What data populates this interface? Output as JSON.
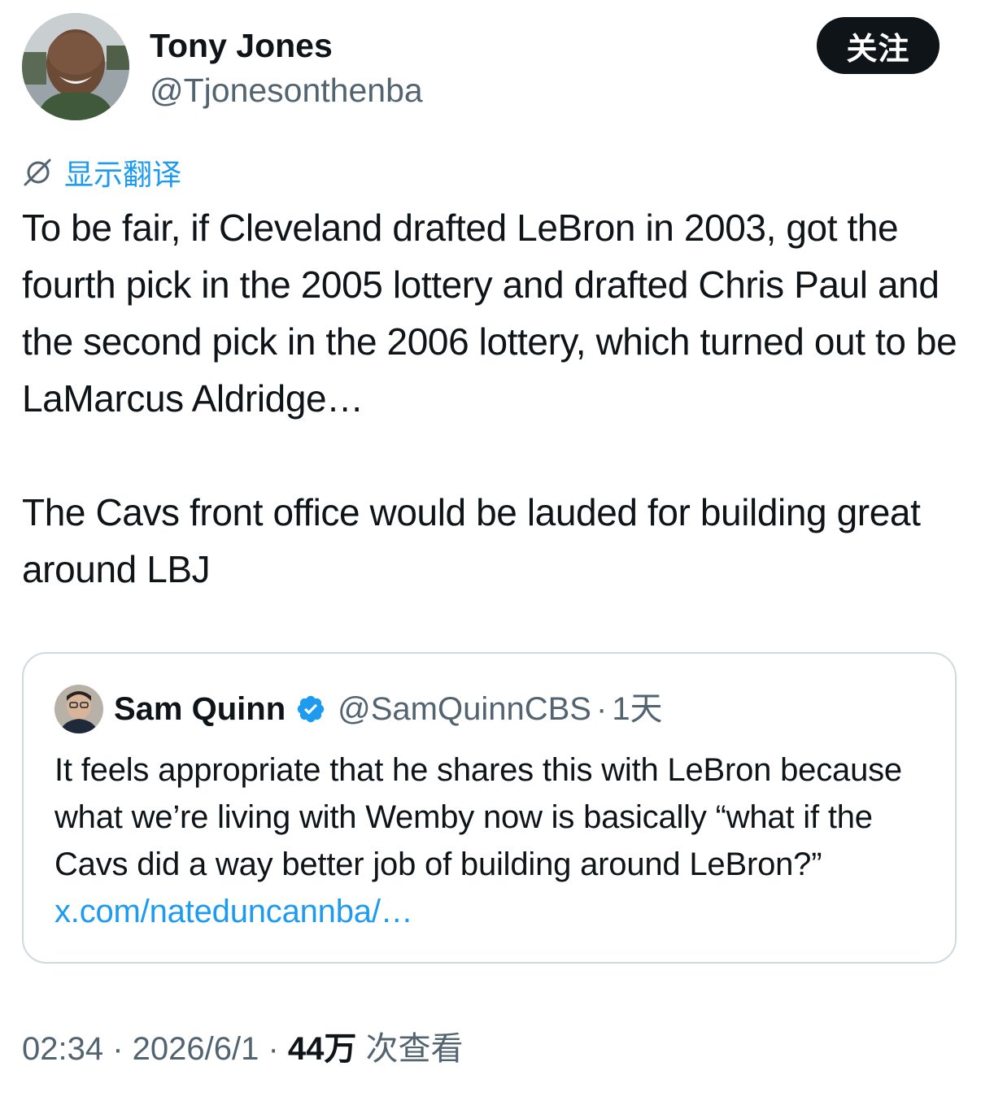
{
  "author": {
    "name": "Tony Jones",
    "handle": "@Tjonesonthenba",
    "avatar_icon": "avatar-photo"
  },
  "follow_button": {
    "label": "关注"
  },
  "translate": {
    "label": "显示翻译",
    "icon": "translate-globe-icon"
  },
  "tweet": {
    "paragraphs": [
      "To be fair, if Cleveland drafted LeBron in 2003, got the fourth pick in the 2005 lottery and drafted Chris Paul and the second pick in the 2006 lottery, which turned out to be LaMarcus Aldridge…",
      "The Cavs front office would be lauded for building great around LBJ"
    ]
  },
  "quote": {
    "name": "Sam Quinn",
    "verified": true,
    "handle": "@SamQuinnCBS",
    "separator": "·",
    "time": "1天",
    "text": "It feels appropriate that he shares this with LeBron because what we’re living with Wemby now is basically “what if the Cavs did a way better job of building around LeBron?”",
    "link": "x.com/nateduncannba/…"
  },
  "meta": {
    "time": "02:34",
    "sep1": " · ",
    "date": "2026/6/1",
    "sep2": " · ",
    "views_count": "44万",
    "views_label": " 次查看"
  },
  "colors": {
    "text": "#0f1419",
    "secondary": "#536471",
    "link": "#1d9bf0",
    "border": "#cfd9de"
  }
}
